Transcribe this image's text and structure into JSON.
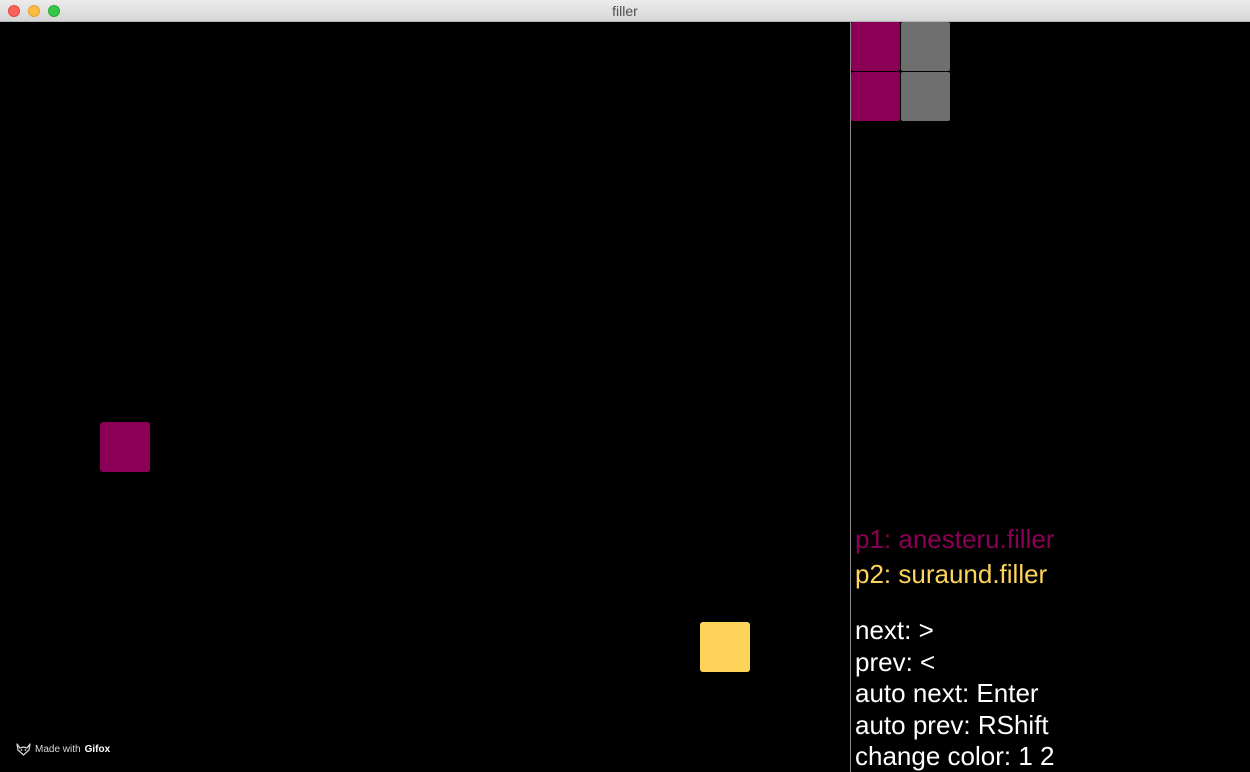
{
  "window": {
    "title": "filler"
  },
  "colors": {
    "p1": "#8b0056",
    "p2": "#ffd45a",
    "empty_piece": "#6f6f6f",
    "background": "#000000",
    "text": "#ffffff"
  },
  "board": {
    "cells": [
      {
        "owner": "p1",
        "row": 8,
        "col": 2
      },
      {
        "owner": "p2",
        "row": 12,
        "col": 14
      }
    ]
  },
  "piece": {
    "cells": [
      {
        "row": 0,
        "col": 0,
        "filled": true
      },
      {
        "row": 0,
        "col": 1,
        "filled": false
      },
      {
        "row": 1,
        "col": 0,
        "filled": true
      },
      {
        "row": 1,
        "col": 1,
        "filled": false
      }
    ]
  },
  "players": {
    "p1_label": "p1: anesteru.filler",
    "p2_label": "p2: suraund.filler"
  },
  "controls": [
    "next: >",
    "prev: <",
    "auto next: Enter",
    "auto prev: RShift",
    "change color: 1 2"
  ],
  "watermark": {
    "prefix": "Made with",
    "brand": "Gifox",
    "icon": "fox-icon"
  }
}
